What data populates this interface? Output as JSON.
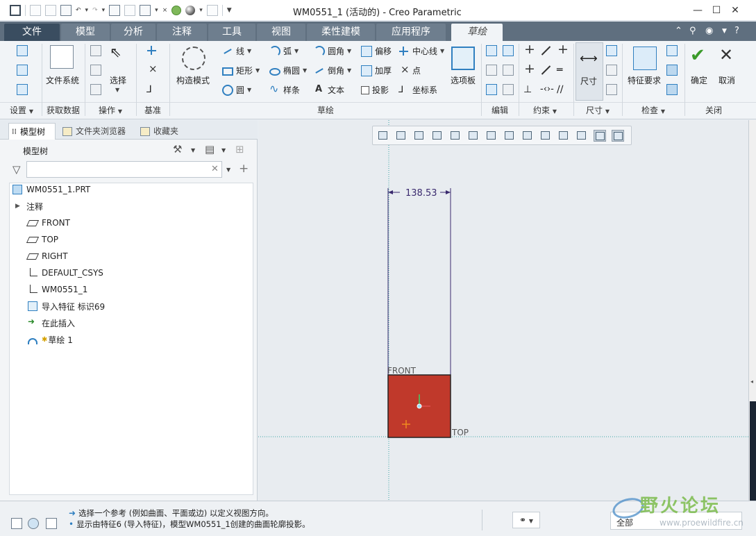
{
  "window": {
    "title": "WM0551_1 (活动的) - Creo Parametric",
    "buttons": [
      "minimize",
      "maximize",
      "close"
    ]
  },
  "menu": {
    "tabs": [
      {
        "label": "文件"
      },
      {
        "label": "模型"
      },
      {
        "label": "分析"
      },
      {
        "label": "注释"
      },
      {
        "label": "工具"
      },
      {
        "label": "视图"
      },
      {
        "label": "柔性建模"
      },
      {
        "label": "应用程序"
      },
      {
        "label": "草绘"
      }
    ],
    "active_tab": "草绘"
  },
  "ribbon": {
    "groups": {
      "setup": "设置",
      "get_data": "获取数据",
      "operations": "操作",
      "datum": "基准",
      "sketch": "草绘",
      "edit": "编辑",
      "constrain": "约束",
      "dimension": "尺寸",
      "inspect": "检查",
      "close": "关闭"
    },
    "buttons": {
      "file_system": "文件系统",
      "select": "选择",
      "construction_mode": "构造模式",
      "line": "线",
      "rectangle": "矩形",
      "circle": "圆",
      "arc": "弧",
      "ellipse": "椭圆",
      "spline": "样条",
      "fillet": "圆角",
      "chamfer": "倒角",
      "text": "文本",
      "offset": "偏移",
      "thicken": "加厚",
      "project": "投影",
      "centerline": "中心线",
      "point": "点",
      "csys": "坐标系",
      "palette": "选项板",
      "dimension": "尺寸",
      "feature_requirements": "特征要求",
      "ok": "确定",
      "cancel": "取消"
    }
  },
  "left_panel": {
    "tabs": [
      {
        "label": "模型树"
      },
      {
        "label": "文件夹浏览器"
      },
      {
        "label": "收藏夹"
      }
    ],
    "header": "模型树",
    "search": {
      "value": "",
      "placeholder": ""
    },
    "tree": [
      {
        "label": "WM0551_1.PRT",
        "icon": "part-icon"
      },
      {
        "label": "注释",
        "icon": "expander-icon"
      },
      {
        "label": "FRONT",
        "icon": "datum-plane-icon"
      },
      {
        "label": "TOP",
        "icon": "datum-plane-icon"
      },
      {
        "label": "RIGHT",
        "icon": "datum-plane-icon"
      },
      {
        "label": "DEFAULT_CSYS",
        "icon": "csys-icon"
      },
      {
        "label": "WM0551_1",
        "icon": "csys-icon"
      },
      {
        "label": "导入特征 标识69",
        "icon": "import-feature-icon"
      },
      {
        "label": "在此插入",
        "icon": "insert-here-icon"
      },
      {
        "label": "草绘 1",
        "icon": "sketch-icon"
      }
    ]
  },
  "graphics": {
    "dimension_value": "138.53",
    "plane_labels": {
      "front": "FRONT",
      "top": "TOP"
    },
    "sketch_fill": "#c0392b",
    "dimension_color": "#3a2a6e"
  },
  "status": {
    "messages": [
      "选择一个参考 (例如曲面、平面或边) 以定义视图方向。",
      "显示由特征6 (导入特征)，模型WM0551_1创建的曲面轮廓投影。"
    ],
    "filter": "全部"
  },
  "watermark": {
    "text": "野火论坛",
    "url": "www.proewildfire.cn"
  },
  "colors": {
    "menubar": "#5f6f7f",
    "accent_blue": "#2f7fc0",
    "ok_green": "#3a9a2a"
  }
}
